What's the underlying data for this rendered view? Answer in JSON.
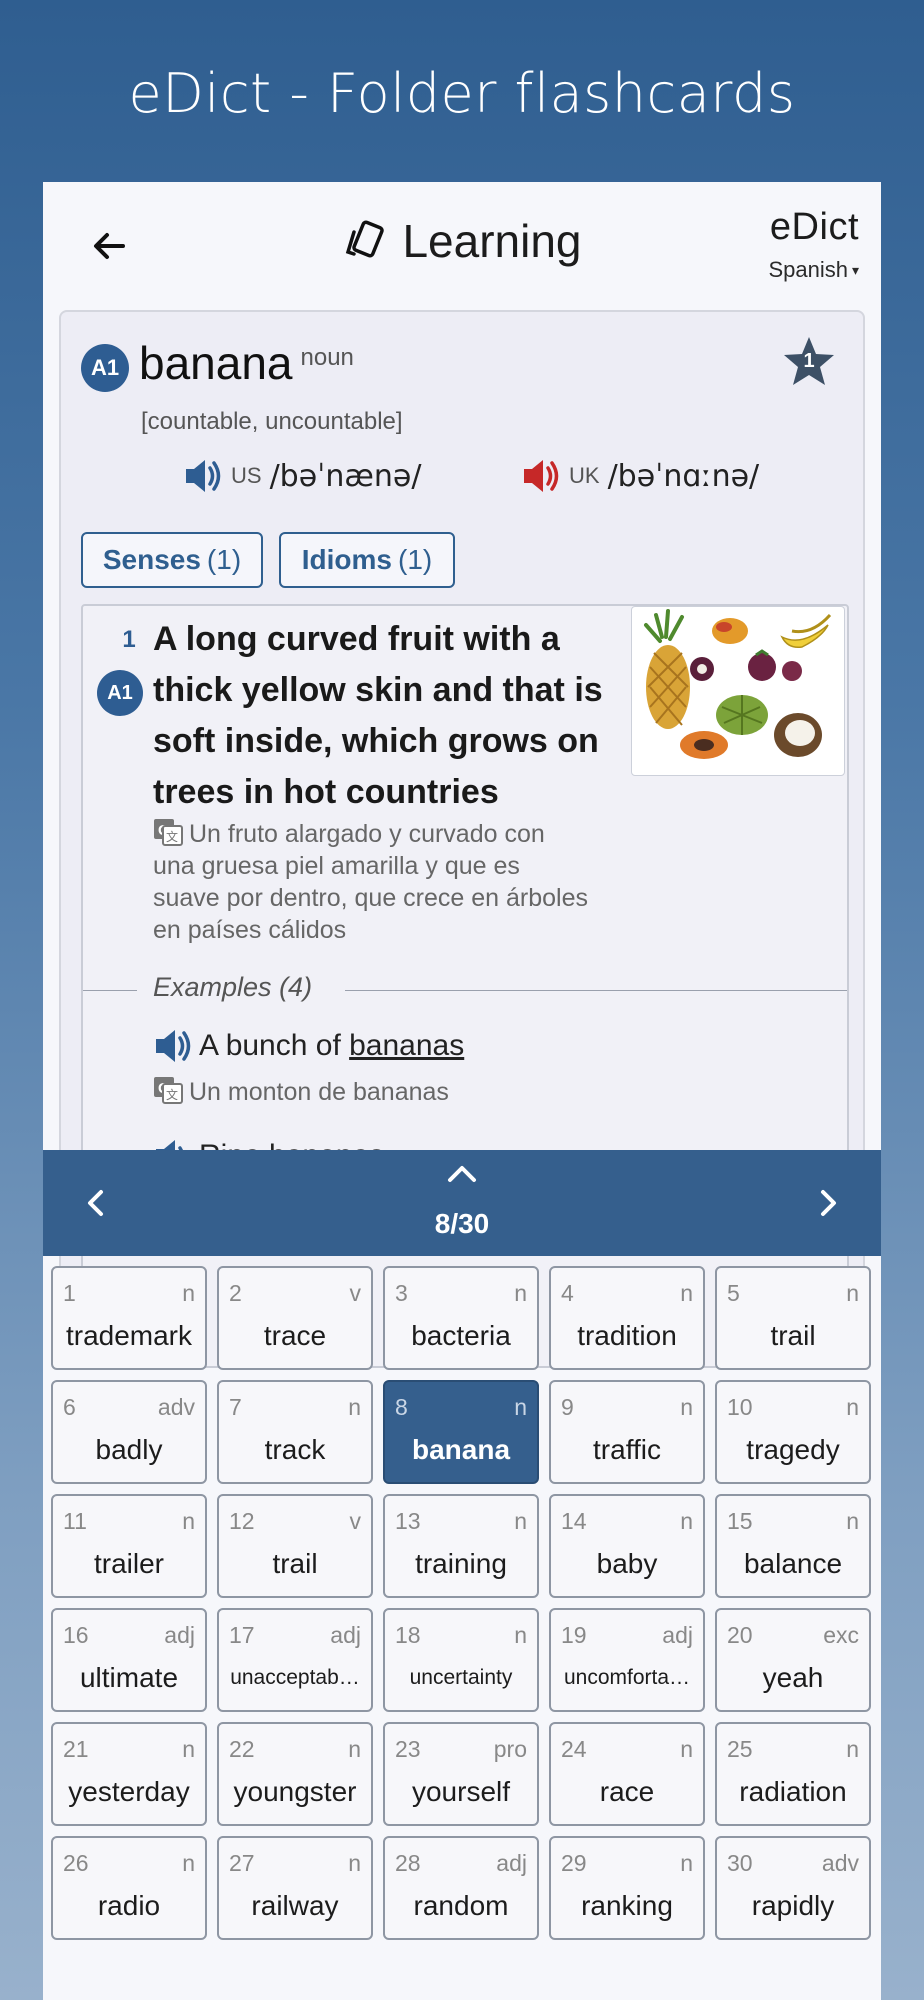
{
  "page_title": "eDict - Folder flashcards",
  "header": {
    "title": "Learning",
    "brand": "eDict",
    "language": "Spanish",
    "language_caret": "▾"
  },
  "entry": {
    "level": "A1",
    "word": "banana",
    "pos": "noun",
    "grammar": "[countable, uncountable]",
    "star_count": "1",
    "pron_us_region": "US",
    "pron_us_ipa": "/bəˈnænə/",
    "pron_uk_region": "UK",
    "pron_uk_ipa": "/bəˈnɑːnə/",
    "senses_label": "Senses",
    "senses_count": "(1)",
    "idioms_label": "Idioms",
    "idioms_count": "(1)"
  },
  "sense": {
    "number": "1",
    "level": "A1",
    "definition": "A long curved fruit with a thick yellow skin and that is soft inside, which grows on trees in hot countries",
    "translation": "Un fruto alargado y curvado con una gruesa piel amarilla y que es suave por dentro, que crece en árboles en países cálidos",
    "examples_label": "Examples",
    "examples_count": "(4)",
    "example1_prefix": "A bunch of ",
    "example1_word": "bananas",
    "example1_translation": "Un monton de bananas",
    "example2_text": "Ripe bananas"
  },
  "nav": {
    "counter": "8/30"
  },
  "colors": {
    "accent": "#355f8d",
    "us_speaker": "#2e5d92",
    "uk_speaker": "#c62828"
  },
  "cards": [
    {
      "n": "1",
      "pos": "n",
      "word": "trademark"
    },
    {
      "n": "2",
      "pos": "v",
      "word": "trace"
    },
    {
      "n": "3",
      "pos": "n",
      "word": "bacteria"
    },
    {
      "n": "4",
      "pos": "n",
      "word": "tradition"
    },
    {
      "n": "5",
      "pos": "n",
      "word": "trail"
    },
    {
      "n": "6",
      "pos": "adv",
      "word": "badly"
    },
    {
      "n": "7",
      "pos": "n",
      "word": "track"
    },
    {
      "n": "8",
      "pos": "n",
      "word": "banana"
    },
    {
      "n": "9",
      "pos": "n",
      "word": "traffic"
    },
    {
      "n": "10",
      "pos": "n",
      "word": "tragedy"
    },
    {
      "n": "11",
      "pos": "n",
      "word": "trailer"
    },
    {
      "n": "12",
      "pos": "v",
      "word": "trail"
    },
    {
      "n": "13",
      "pos": "n",
      "word": "training"
    },
    {
      "n": "14",
      "pos": "n",
      "word": "baby"
    },
    {
      "n": "15",
      "pos": "n",
      "word": "balance"
    },
    {
      "n": "16",
      "pos": "adj",
      "word": "ultimate"
    },
    {
      "n": "17",
      "pos": "adj",
      "word": "unacceptab…"
    },
    {
      "n": "18",
      "pos": "n",
      "word": "uncertainty"
    },
    {
      "n": "19",
      "pos": "adj",
      "word": "uncomforta…"
    },
    {
      "n": "20",
      "pos": "exc",
      "word": "yeah"
    },
    {
      "n": "21",
      "pos": "n",
      "word": "yesterday"
    },
    {
      "n": "22",
      "pos": "n",
      "word": "youngster"
    },
    {
      "n": "23",
      "pos": "pro",
      "word": "yourself"
    },
    {
      "n": "24",
      "pos": "n",
      "word": "race"
    },
    {
      "n": "25",
      "pos": "n",
      "word": "radiation"
    },
    {
      "n": "26",
      "pos": "n",
      "word": "radio"
    },
    {
      "n": "27",
      "pos": "n",
      "word": "railway"
    },
    {
      "n": "28",
      "pos": "adj",
      "word": "random"
    },
    {
      "n": "29",
      "pos": "n",
      "word": "ranking"
    },
    {
      "n": "30",
      "pos": "adv",
      "word": "rapidly"
    }
  ]
}
